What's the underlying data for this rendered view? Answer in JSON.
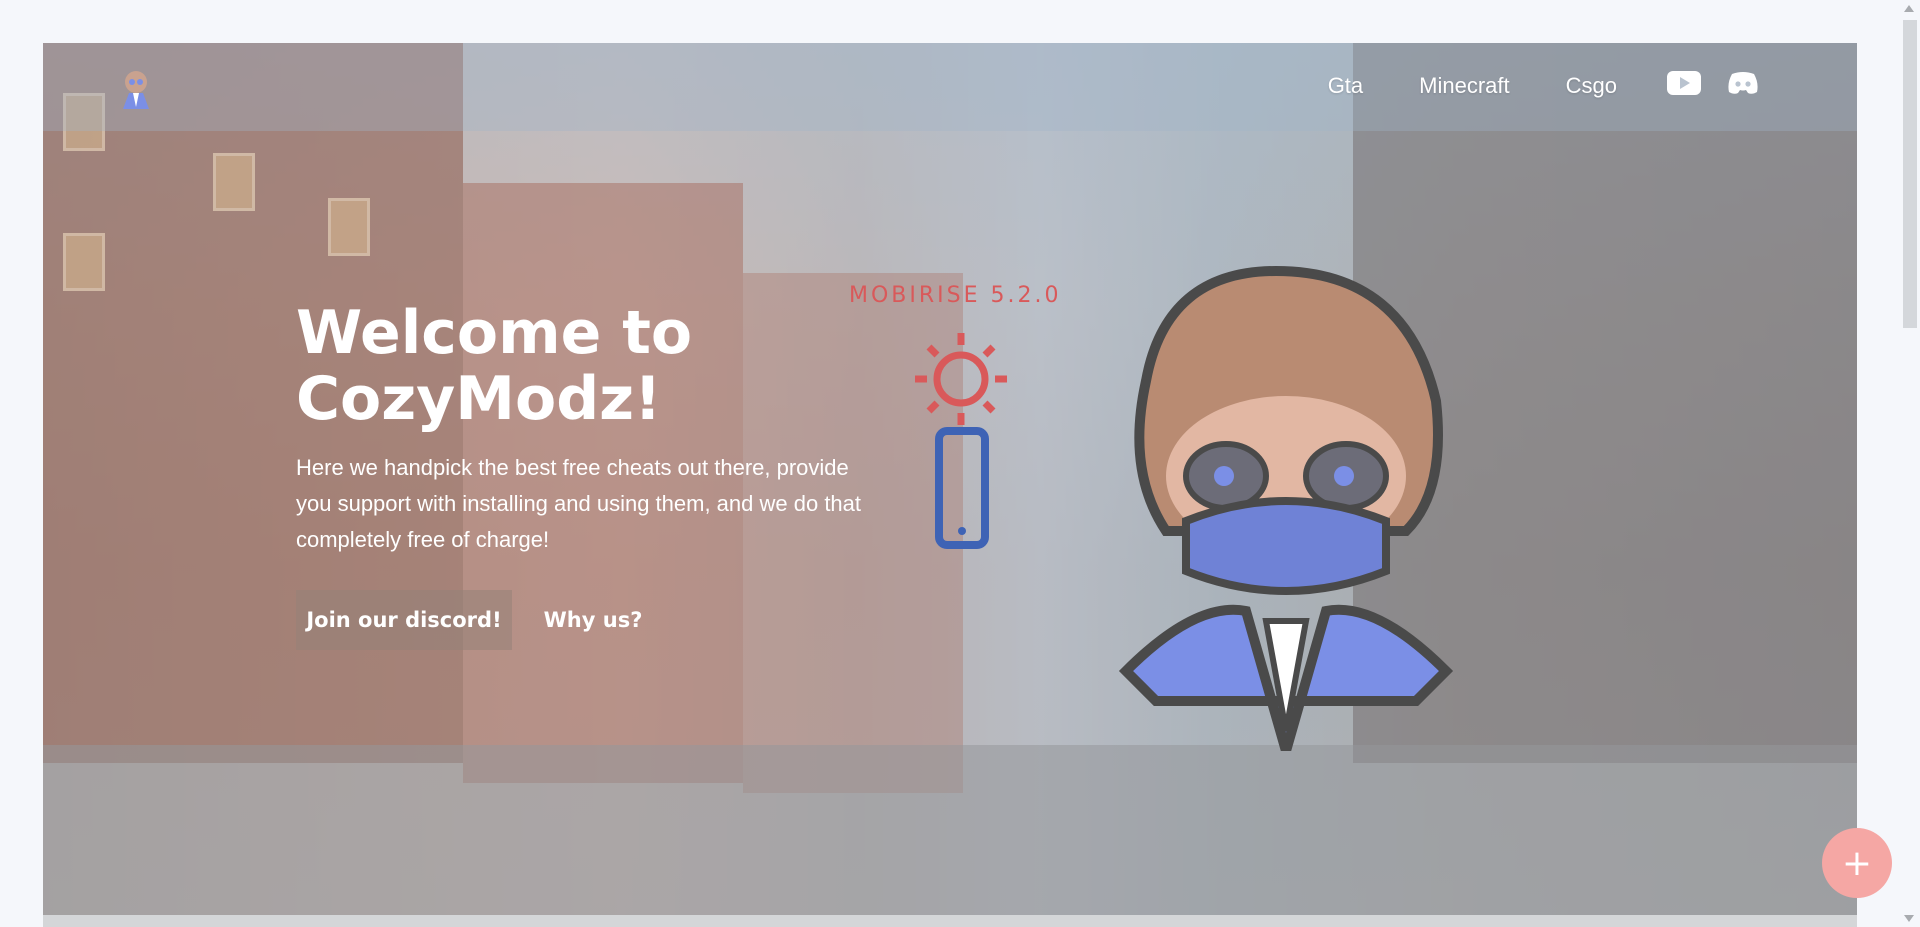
{
  "navbar": {
    "logo": "cozymodz-mascot-logo",
    "links": [
      {
        "label": "Gta"
      },
      {
        "label": "Minecraft"
      },
      {
        "label": "Csgo"
      }
    ],
    "social": [
      "youtube-icon",
      "discord-icon"
    ]
  },
  "hero": {
    "title": "Welcome to CozyModz!",
    "subtitle": "Here we handpick the best free cheats out there, provide you support with installing and using them, and we do that completely free of charge!",
    "buttons": {
      "primary": "Join our discord!",
      "secondary": "Why us?"
    },
    "badge": "MOBIRISE  5.2.0"
  },
  "fab": {
    "label": "+"
  },
  "colors": {
    "badge": "#d9595a",
    "fab": "#f5a7a4",
    "mascot_hood": "#7b8fe6",
    "phone": "#3e63b5"
  }
}
